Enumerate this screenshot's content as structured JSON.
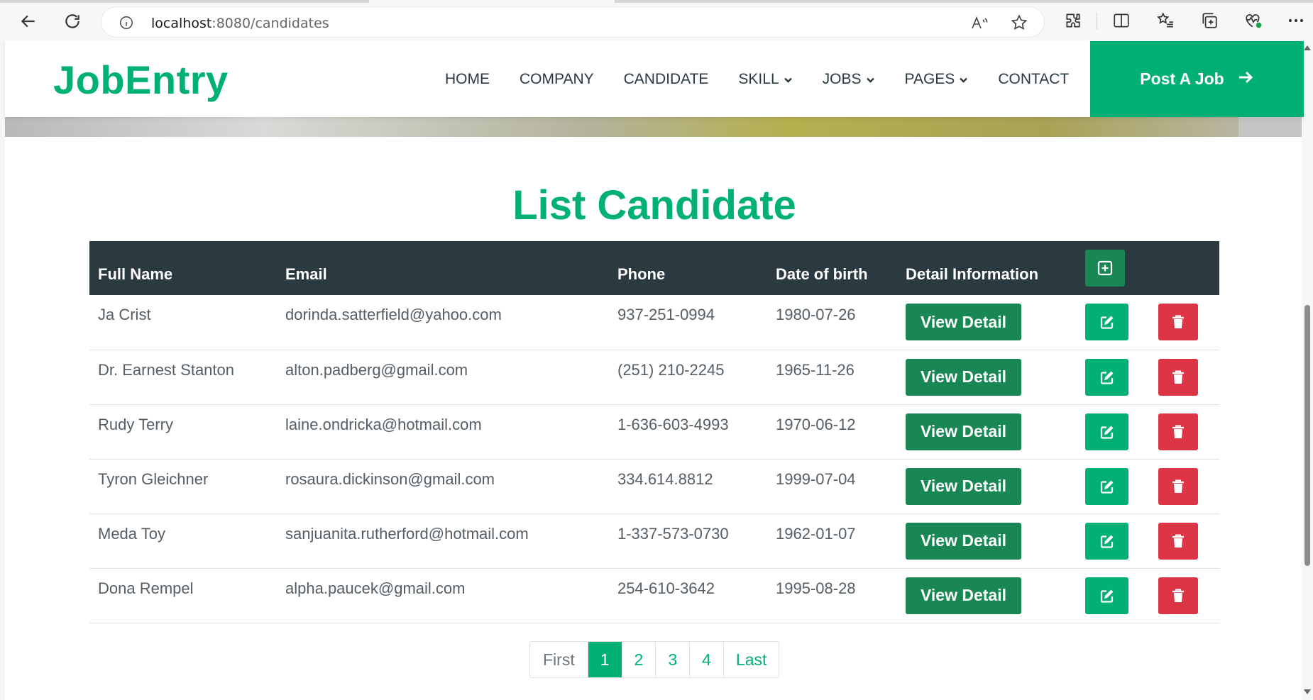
{
  "browser": {
    "url_host": "localhost",
    "url_path": ":8080/candidates"
  },
  "navbar": {
    "brand": "JobEntry",
    "links": [
      {
        "label": "HOME",
        "has_caret": false
      },
      {
        "label": "COMPANY",
        "has_caret": false
      },
      {
        "label": "CANDIDATE",
        "has_caret": false
      },
      {
        "label": "SKILL",
        "has_caret": true
      },
      {
        "label": "JOBS",
        "has_caret": true
      },
      {
        "label": "PAGES",
        "has_caret": true
      },
      {
        "label": "CONTACT",
        "has_caret": false
      }
    ],
    "post_job": "Post A Job"
  },
  "main": {
    "title": "List Candidate",
    "columns": [
      "Full Name",
      "Email",
      "Phone",
      "Date of birth",
      "Detail Information"
    ],
    "view_label": "View Detail",
    "rows": [
      {
        "name": "Ja Crist",
        "email": "dorinda.satterfield@yahoo.com",
        "phone": "937-251-0994",
        "dob": "1980-07-26"
      },
      {
        "name": "Dr. Earnest Stanton",
        "email": "alton.padberg@gmail.com",
        "phone": "(251) 210-2245",
        "dob": "1965-11-26"
      },
      {
        "name": "Rudy Terry",
        "email": "laine.ondricka@hotmail.com",
        "phone": "1-636-603-4993",
        "dob": "1970-06-12"
      },
      {
        "name": "Tyron Gleichner",
        "email": "rosaura.dickinson@gmail.com",
        "phone": "334.614.8812",
        "dob": "1999-07-04"
      },
      {
        "name": "Meda Toy",
        "email": "sanjuanita.rutherford@hotmail.com",
        "phone": "1-337-573-0730",
        "dob": "1962-01-07"
      },
      {
        "name": "Dona Rempel",
        "email": "alpha.paucek@gmail.com",
        "phone": "254-610-3642",
        "dob": "1995-08-28"
      }
    ]
  },
  "pagination": {
    "first": "First",
    "pages": [
      "1",
      "2",
      "3",
      "4"
    ],
    "active": "1",
    "last": "Last"
  },
  "colors": {
    "accent": "#00b074",
    "header_dark": "#2b3940",
    "view_button": "#198754",
    "delete_button": "#dc3545"
  }
}
